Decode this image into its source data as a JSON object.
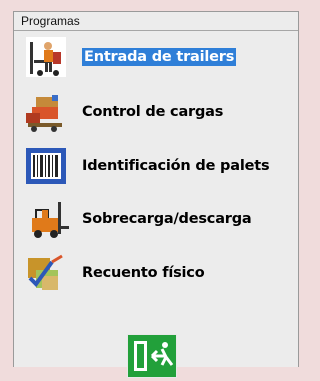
{
  "window": {
    "title": "Programas"
  },
  "menu": {
    "items": [
      {
        "label": "Entrada de trailers",
        "icon": "forklift-worker-icon",
        "selected": true
      },
      {
        "label": "Control de cargas",
        "icon": "cargo-pallets-icon"
      },
      {
        "label": "Identificación de palets",
        "icon": "barcode-icon"
      },
      {
        "label": "Sobrecarga/descarga",
        "icon": "forklift-icon"
      },
      {
        "label": "Recuento físico",
        "icon": "inventory-check-icon"
      }
    ]
  },
  "exit": {
    "icon": "exit-door-icon",
    "color": "#22a03a"
  },
  "colors": {
    "selection": "#2f7fd8",
    "panel": "#ececec",
    "background": "#f0dcdc"
  }
}
